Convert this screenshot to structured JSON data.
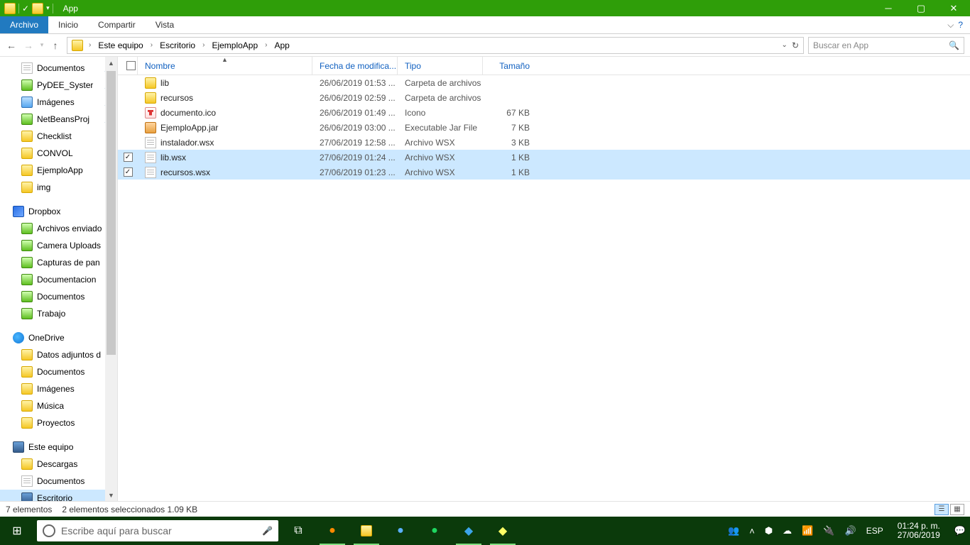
{
  "titlebar": {
    "title": "App"
  },
  "ribbon": {
    "archivo": "Archivo",
    "tabs": [
      "Inicio",
      "Compartir",
      "Vista"
    ]
  },
  "breadcrumbs": [
    "Este equipo",
    "Escritorio",
    "EjemploApp",
    "App"
  ],
  "search": {
    "placeholder": "Buscar en App"
  },
  "sidebar": [
    {
      "label": "Documentos",
      "icon": "doc",
      "depth": 2,
      "pinned": true
    },
    {
      "label": "PyDEE_Syster",
      "icon": "green",
      "depth": 2,
      "pinned": true
    },
    {
      "label": "Imágenes",
      "icon": "pic",
      "depth": 2,
      "pinned": true
    },
    {
      "label": "NetBeansProj",
      "icon": "green",
      "depth": 2,
      "pinned": true
    },
    {
      "label": "Checklist",
      "icon": "folder",
      "depth": 2
    },
    {
      "label": "CONVOL",
      "icon": "folder",
      "depth": 2
    },
    {
      "label": "EjemploApp",
      "icon": "folder",
      "depth": 2
    },
    {
      "label": "img",
      "icon": "folder",
      "depth": 2
    },
    {
      "label": "",
      "spacer": true
    },
    {
      "label": "Dropbox",
      "icon": "db",
      "depth": 1
    },
    {
      "label": "Archivos enviado",
      "icon": "green",
      "depth": 2
    },
    {
      "label": "Camera Uploads",
      "icon": "green",
      "depth": 2
    },
    {
      "label": "Capturas de pan",
      "icon": "green",
      "depth": 2
    },
    {
      "label": "Documentacion",
      "icon": "green",
      "depth": 2
    },
    {
      "label": "Documentos",
      "icon": "green",
      "depth": 2
    },
    {
      "label": "Trabajo",
      "icon": "green",
      "depth": 2
    },
    {
      "label": "",
      "spacer": true
    },
    {
      "label": "OneDrive",
      "icon": "od",
      "depth": 1
    },
    {
      "label": "Datos adjuntos d",
      "icon": "folder",
      "depth": 2
    },
    {
      "label": "Documentos",
      "icon": "folder",
      "depth": 2
    },
    {
      "label": "Imágenes",
      "icon": "folder",
      "depth": 2
    },
    {
      "label": "Música",
      "icon": "folder",
      "depth": 2
    },
    {
      "label": "Proyectos",
      "icon": "folder",
      "depth": 2
    },
    {
      "label": "",
      "spacer": true
    },
    {
      "label": "Este equipo",
      "icon": "pc",
      "depth": 1
    },
    {
      "label": "Descargas",
      "icon": "folder",
      "depth": 2
    },
    {
      "label": "Documentos",
      "icon": "doc",
      "depth": 2
    },
    {
      "label": "Escritorio",
      "icon": "pc",
      "depth": 2,
      "selected": true
    }
  ],
  "columns": {
    "name": "Nombre",
    "date": "Fecha de modifica...",
    "type": "Tipo",
    "size": "Tamaño"
  },
  "files": [
    {
      "name": "lib",
      "date": "26/06/2019 01:53 ...",
      "type": "Carpeta de archivos",
      "size": "",
      "icon": "folder"
    },
    {
      "name": "recursos",
      "date": "26/06/2019 02:59 ...",
      "type": "Carpeta de archivos",
      "size": "",
      "icon": "folder"
    },
    {
      "name": "documento.ico",
      "date": "26/06/2019 01:49 ...",
      "type": "Icono",
      "size": "67 KB",
      "icon": "ico"
    },
    {
      "name": "EjemploApp.jar",
      "date": "26/06/2019 03:00 ...",
      "type": "Executable Jar File",
      "size": "7 KB",
      "icon": "jar"
    },
    {
      "name": "instalador.wsx",
      "date": "27/06/2019 12:58 ...",
      "type": "Archivo WSX",
      "size": "3 KB",
      "icon": "doc"
    },
    {
      "name": "lib.wsx",
      "date": "27/06/2019 01:24 ...",
      "type": "Archivo WSX",
      "size": "1 KB",
      "icon": "doc",
      "selected": true,
      "checked": true
    },
    {
      "name": "recursos.wsx",
      "date": "27/06/2019 01:23 ...",
      "type": "Archivo WSX",
      "size": "1 KB",
      "icon": "doc",
      "selected": true,
      "checked": true
    }
  ],
  "status": {
    "count": "7 elementos",
    "selected": "2 elementos seleccionados  1.09 KB"
  },
  "cortana": {
    "placeholder": "Escribe aquí para buscar"
  },
  "tray": {
    "lang": "ESP",
    "time": "01:24 p. m.",
    "date": "27/06/2019"
  }
}
